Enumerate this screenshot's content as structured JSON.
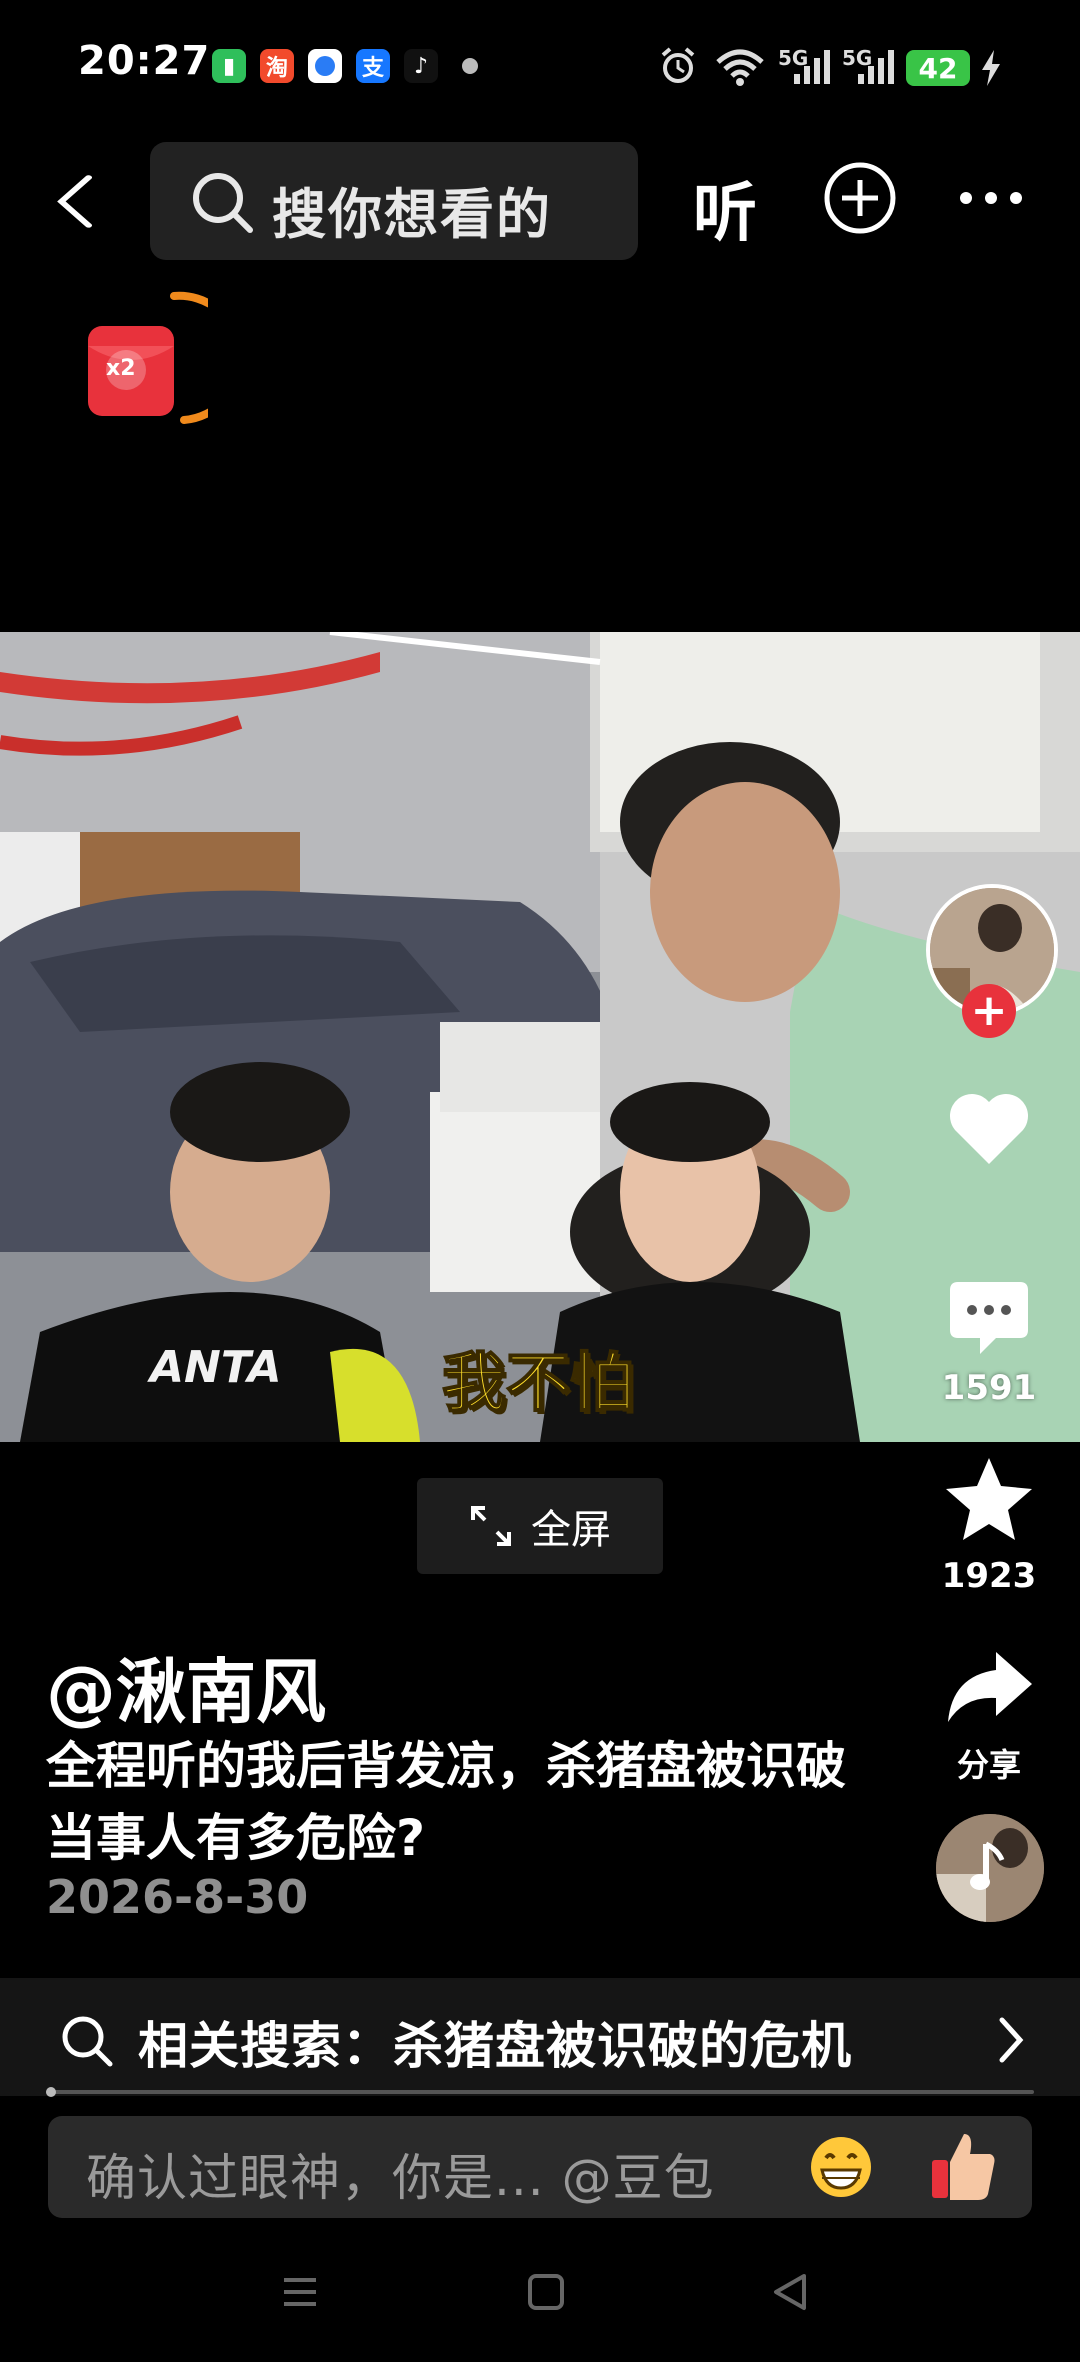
{
  "status_bar": {
    "time": "20:27",
    "apps": [
      "battery-saver-app",
      "taobao-app",
      "blue-app",
      "alipay-app",
      "tiktok-app"
    ],
    "alipay_glyph": "支",
    "taobao_glyph": "淘",
    "signal1": "5G",
    "signal2": "5G",
    "battery": "42"
  },
  "top_bar": {
    "search_placeholder": "搜你想看的",
    "listen_label": "听"
  },
  "reward": {
    "multiplier": "x2"
  },
  "video": {
    "subtitle": "我不怕",
    "shirt_text": "ANTA"
  },
  "right_rail": {
    "comments": "1591",
    "favorites": "1923",
    "share_label": "分享"
  },
  "fullscreen": {
    "label": "全屏"
  },
  "caption": {
    "author": "@湫南风",
    "description": "全程听的我后背发凉，杀猪盘被识破当事人有多危险?",
    "date": "2026-8-30"
  },
  "related_search": {
    "text": "相关搜索：杀猪盘被识破的危机"
  },
  "comment_box": {
    "placeholder": "确认过眼神，你是... @豆包"
  },
  "colors": {
    "accent_red": "#e8323c",
    "ring_orange": "#f08a1c",
    "battery_green": "#39c447"
  }
}
